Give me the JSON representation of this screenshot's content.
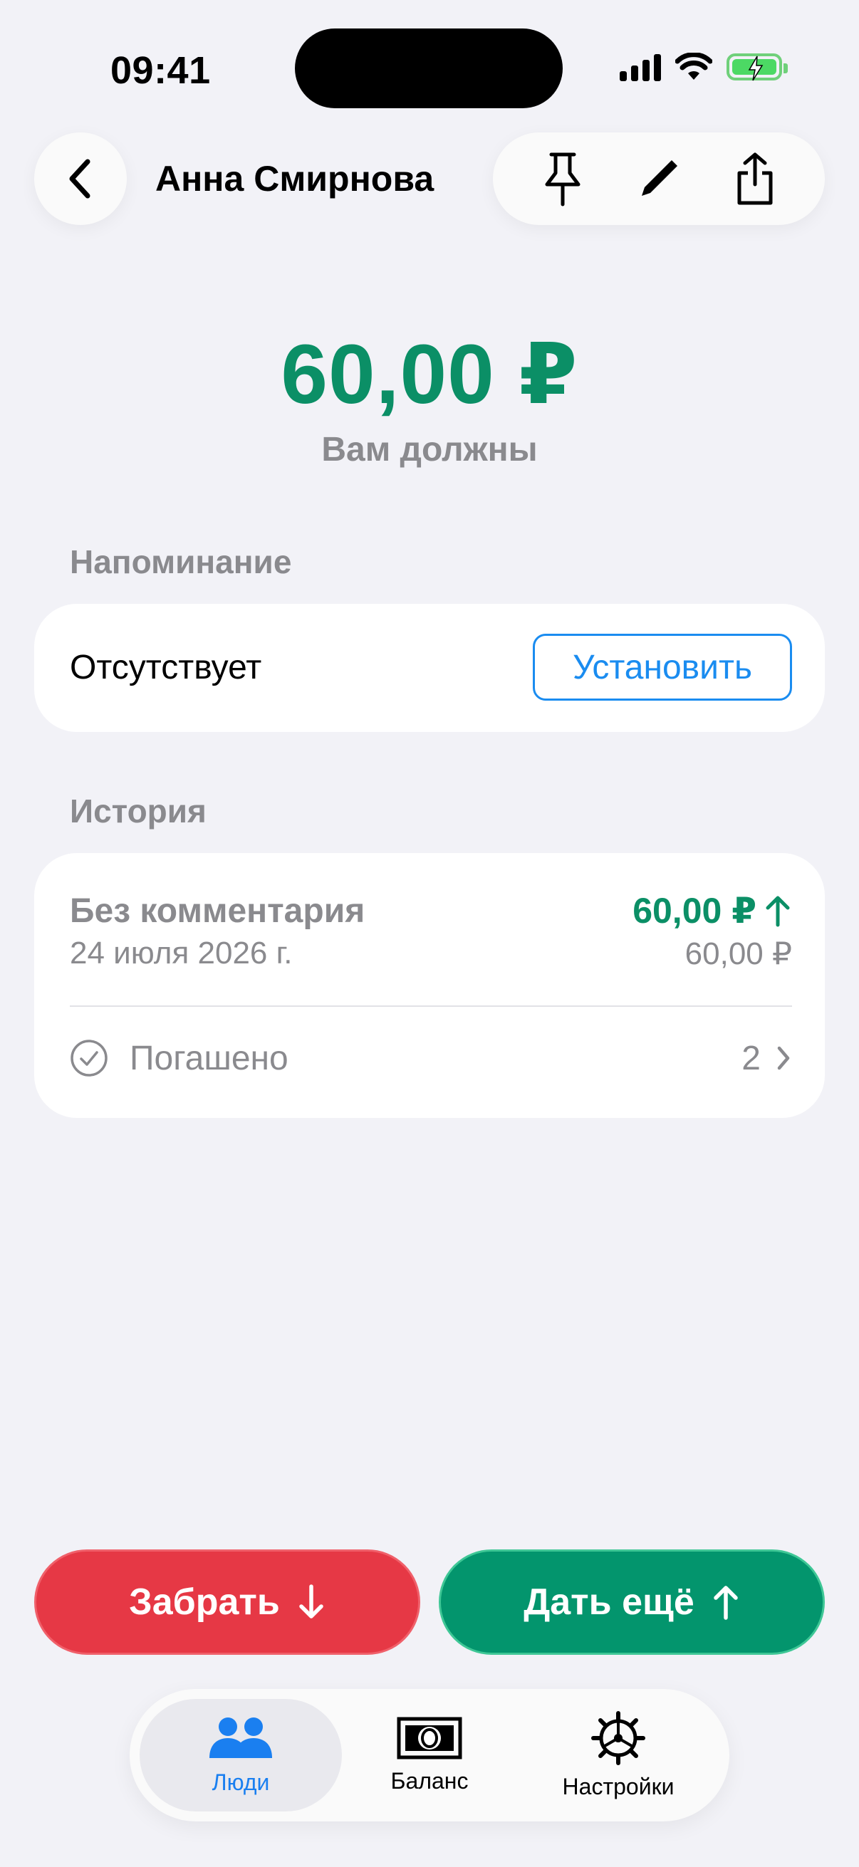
{
  "status_bar": {
    "time": "09:41"
  },
  "header": {
    "title": "Анна Смирнова",
    "back_icon": "chevron-left-icon",
    "actions": [
      "pin-icon",
      "pencil-icon",
      "share-icon"
    ]
  },
  "summary": {
    "amount": "60,00 ₽",
    "caption": "Вам должны"
  },
  "reminder": {
    "section_title": "Напоминание",
    "status": "Отсутствует",
    "set_label": "Установить"
  },
  "history": {
    "section_title": "История",
    "entry": {
      "comment": "Без комментария",
      "date": "24 июля 2026 г.",
      "amount": "60,00 ₽",
      "balance": "60,00 ₽"
    },
    "repaid": {
      "label": "Погашено",
      "count": "2"
    }
  },
  "buttons": {
    "take_label": "Забрать",
    "give_label": "Дать ещё"
  },
  "tab_bar": {
    "tabs": [
      {
        "label": "Люди",
        "icon": "people-icon",
        "active": true
      },
      {
        "label": "Баланс",
        "icon": "banknote-icon",
        "active": false
      },
      {
        "label": "Настройки",
        "icon": "gear-icon",
        "active": false
      }
    ]
  },
  "colors": {
    "accent_green": "#0b8f66",
    "accent_blue": "#1a8cf0",
    "danger_red": "#e63845",
    "background": "#f2f2f7"
  }
}
